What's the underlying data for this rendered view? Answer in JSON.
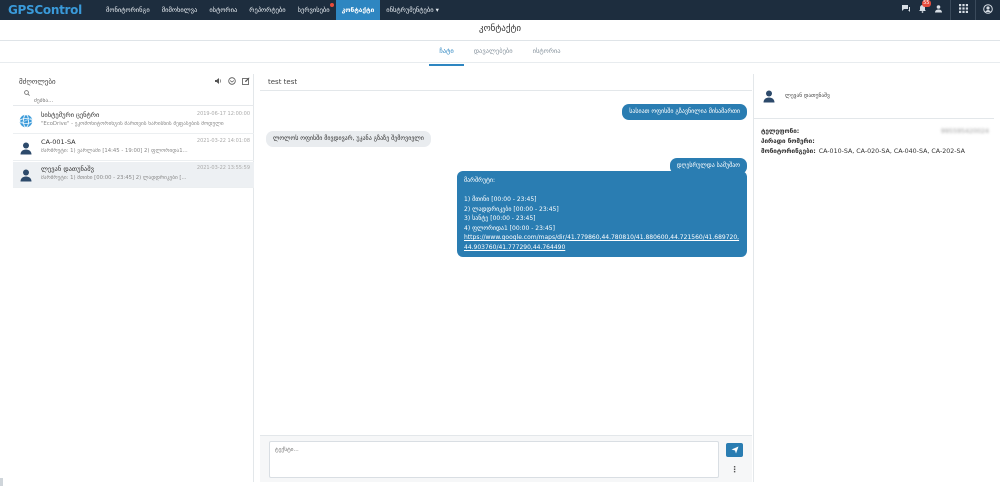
{
  "app": {
    "logo": "GPSControl"
  },
  "nav": {
    "items": [
      {
        "label": "მონიტორინგი",
        "active": false
      },
      {
        "label": "მიმოხილვა",
        "active": false
      },
      {
        "label": "ისტორია",
        "active": false
      },
      {
        "label": "რეპორტები",
        "active": false
      },
      {
        "label": "სერვისები",
        "active": false,
        "dot": true
      },
      {
        "label": "კონტაქტი",
        "active": true
      },
      {
        "label": "ინსტრუმენტები ▾",
        "active": false
      }
    ],
    "notification_count": "55"
  },
  "page": {
    "title": "კონტაქტი",
    "tabs": [
      {
        "label": "ჩატი",
        "active": true
      },
      {
        "label": "დავალებები",
        "active": false
      },
      {
        "label": "ისტორია",
        "active": false
      }
    ]
  },
  "left": {
    "title": "მძღოლები",
    "search_placeholder": "ძებნა...",
    "conversations": [
      {
        "name": "სისტემური ცენტრი",
        "date": "2019-06-17 12:00:00",
        "preview": "\"EcoDrive\" - ეკომონიტორინგის მართვის ხარისხის შეფასების მოდული",
        "avatar": "globe-icon"
      },
      {
        "name": "CA-001-SA",
        "date": "2021-03-22 14:01:08",
        "preview": "მარშრუტი: 1) ვარლამი [14:45 - 19:00] 2) ფლორიდა1...",
        "avatar": "user-icon"
      },
      {
        "name": "ლევან დათუნაშვ",
        "date": "2021-03-22 13:55:59",
        "preview": "მარშრუტი: 1) მთინი [00:00 - 23:45] 2) ლადდრიკები [...",
        "avatar": "user-icon",
        "selected": true
      }
    ]
  },
  "chat": {
    "header": "test test",
    "messages": [
      {
        "dir": "out",
        "text": "სასიათ ოფისში გზავნილია მისამართი"
      },
      {
        "dir": "in",
        "text": "ლოლოს ოფისში მივდივარ, უკანა გზაზე შემოვივლი"
      },
      {
        "dir": "out",
        "text": "დღესრულდა სამუშაო"
      },
      {
        "dir": "out",
        "text": "მარშრუტი:\n\n1) მთინი [00:00 - 23:45]\n2) ლადდრიკები [00:00 - 23:45]\n3) სანტე [00:00 - 23:45]\n4) ფლორიდა1 [00:00 - 23:45]\n",
        "link": "https://www.google.com/maps/dir/41.779860,44.780810/41.880600,44.721560/41.689720,44.903760/41.777290,44.764490"
      }
    ],
    "composer_placeholder": "ტექსტი..."
  },
  "right": {
    "name": "ლევან დათუნაშვ",
    "rows": [
      {
        "label": "ტელეფონი:",
        "value": "995595420024",
        "value_right": true
      },
      {
        "label": "პირადი ნომერი:",
        "value": ""
      },
      {
        "label": "მონიტორინგები:",
        "value": "CA-010-SA, CA-020-SA, CA-040-SA, CA-202-SA"
      }
    ]
  }
}
